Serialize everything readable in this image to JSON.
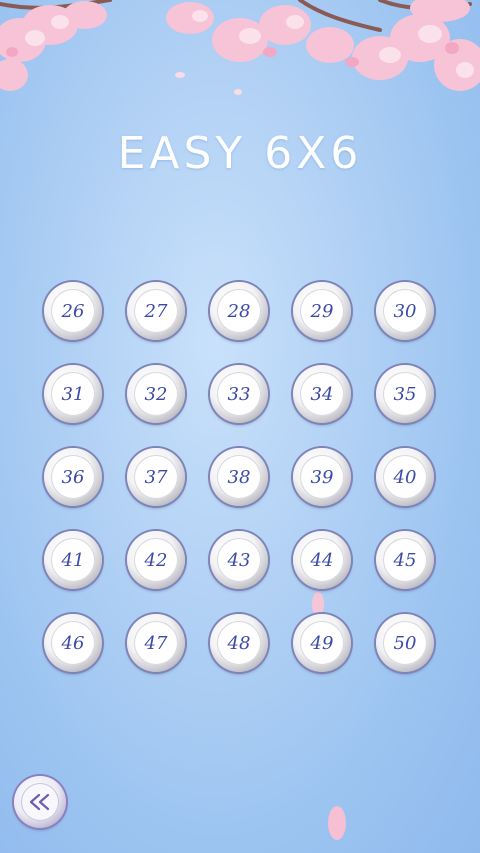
{
  "title": "EASY 6X6",
  "levels": [
    "26",
    "27",
    "28",
    "29",
    "30",
    "31",
    "32",
    "33",
    "34",
    "35",
    "36",
    "37",
    "38",
    "39",
    "40",
    "41",
    "42",
    "43",
    "44",
    "45",
    "46",
    "47",
    "48",
    "49",
    "50"
  ],
  "back_icon": "double-chevron-left-icon",
  "colors": {
    "background": "#a9cdf4",
    "title": "#ffffff",
    "level_text": "#3b4aa8",
    "button_ring": "#7f84b8",
    "blossom": "#f6bfd3"
  }
}
